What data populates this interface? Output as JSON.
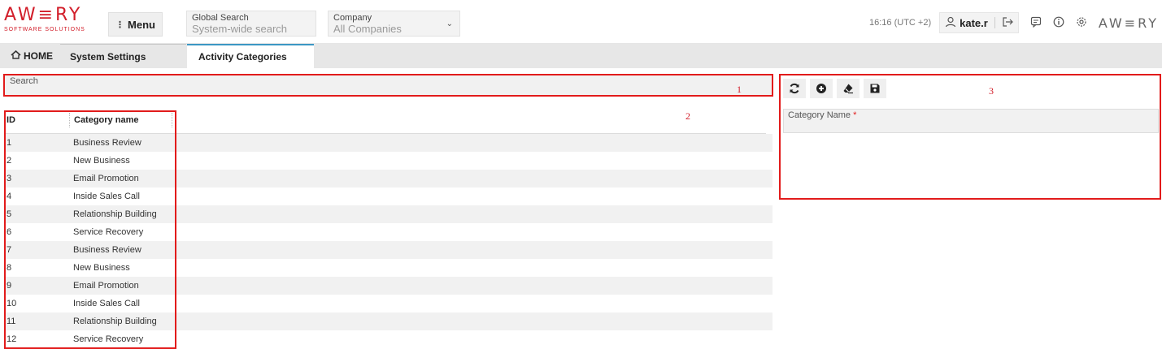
{
  "header": {
    "logo_word": "AW≡RY",
    "logo_sub": "SOFTWARE SOLUTIONS",
    "menu_label": "Menu",
    "global_search": {
      "label": "Global Search",
      "placeholder": "System-wide search"
    },
    "company": {
      "label": "Company",
      "value": "All Companies"
    },
    "time": "16:16 (UTC +2)",
    "user": "kate.r",
    "brand_right": "AW≡RY"
  },
  "tabs": {
    "home": "HOME",
    "system_settings": "System Settings",
    "activity_categories": "Activity Categories"
  },
  "search": {
    "label": "Search"
  },
  "annotations": {
    "one": "1",
    "two": "2",
    "three": "3"
  },
  "grid": {
    "columns": {
      "id": "ID",
      "name": "Category name"
    },
    "rows": [
      {
        "id": "1",
        "name": "Business Review"
      },
      {
        "id": "2",
        "name": "New Business"
      },
      {
        "id": "3",
        "name": "Email Promotion"
      },
      {
        "id": "4",
        "name": "Inside Sales Call"
      },
      {
        "id": "5",
        "name": "Relationship Building"
      },
      {
        "id": "6",
        "name": "Service Recovery"
      },
      {
        "id": "7",
        "name": "Business Review"
      },
      {
        "id": "8",
        "name": "New Business"
      },
      {
        "id": "9",
        "name": "Email Promotion"
      },
      {
        "id": "10",
        "name": "Inside Sales Call"
      },
      {
        "id": "11",
        "name": "Relationship Building"
      },
      {
        "id": "12",
        "name": "Service Recovery"
      }
    ]
  },
  "form": {
    "category_name_label": "Category Name",
    "required_mark": "*",
    "toolbar_icons": [
      "refresh-icon",
      "add-circle-icon",
      "eraser-icon",
      "save-icon"
    ]
  },
  "colors": {
    "brand_red": "#d21e2a",
    "annotation_red": "#e21b1b",
    "tab_accent": "#3c97c4"
  }
}
